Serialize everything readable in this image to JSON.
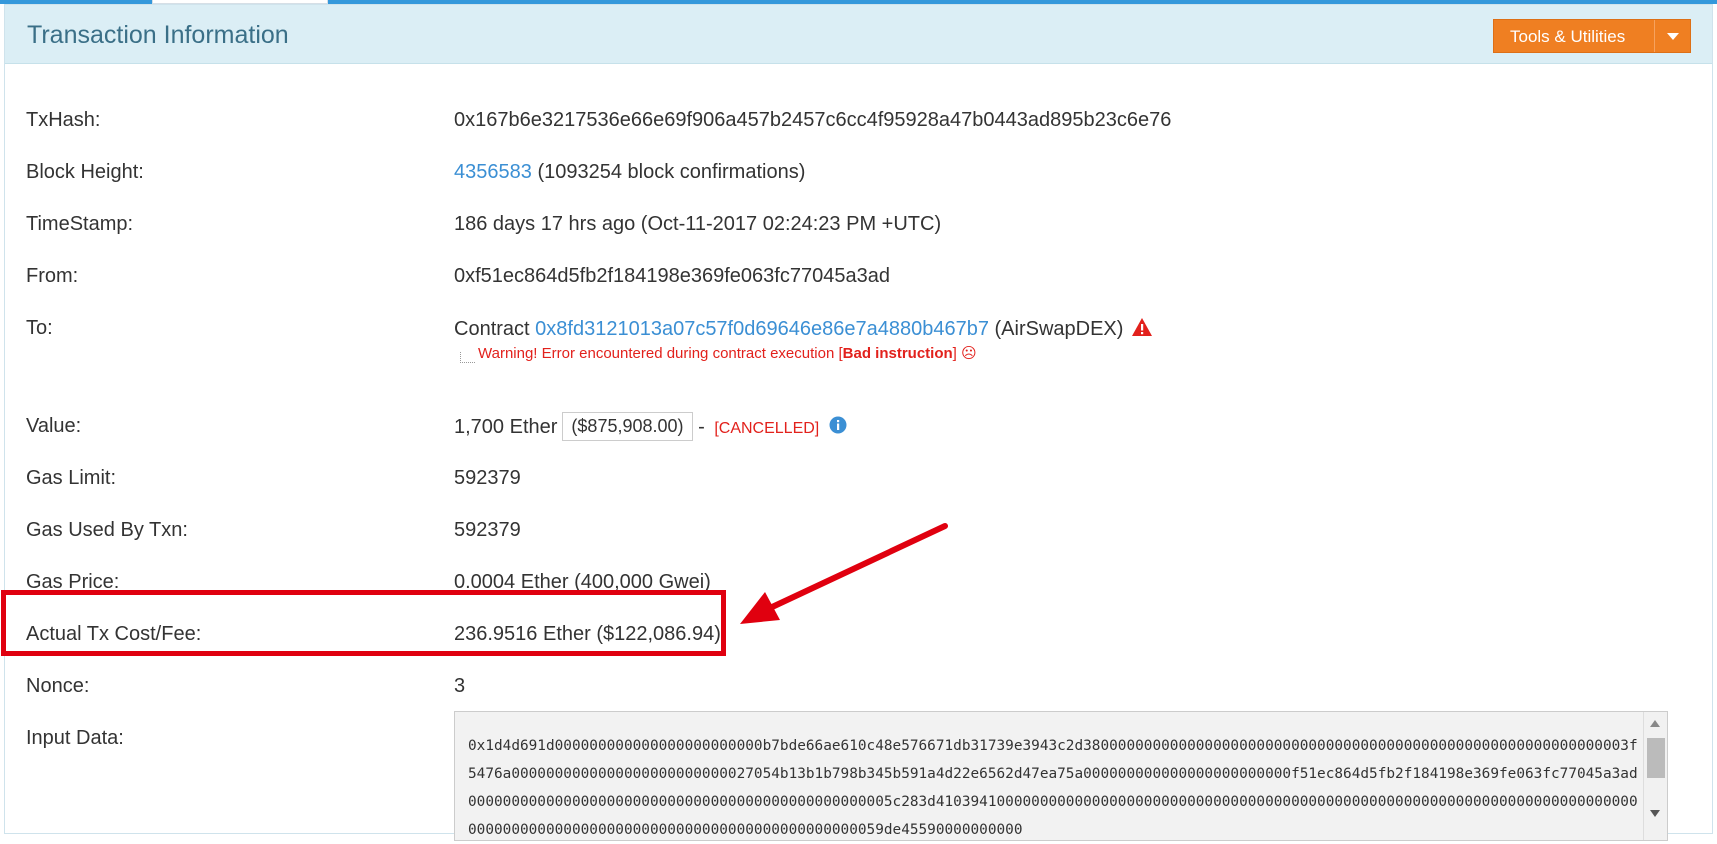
{
  "panel": {
    "title": "Transaction Information",
    "tools_button": "Tools & Utilities"
  },
  "rows": {
    "txhash": {
      "label": "TxHash:",
      "value": "0x167b6e3217536e66e69f906a457b2457c6cc4f95928a47b0443ad895b23c6e76"
    },
    "block_height": {
      "label": "Block Height:",
      "block": "4356583",
      "confirmations": "(1093254 block confirmations)"
    },
    "timestamp": {
      "label": "TimeStamp:",
      "value": "186 days 17 hrs ago (Oct-11-2017 02:24:23 PM +UTC)"
    },
    "from": {
      "label": "From:",
      "address": "0xf51ec864d5fb2f184198e369fe063fc77045a3ad"
    },
    "to": {
      "label": "To:",
      "prefix": "Contract",
      "address": "0x8fd3121013a07c57f0d69646e86e7a4880b467b7",
      "name": "(AirSwapDEX)",
      "warning_prefix": "Warning! Error encountered during contract execution [",
      "warning_bold": "Bad instruction",
      "warning_suffix": "]",
      "warning_face": "☹"
    },
    "value": {
      "label": "Value:",
      "amount": "1,700 Ether",
      "usd": "($875,908.00)",
      "dash": "-",
      "status": "[CANCELLED]"
    },
    "gas_limit": {
      "label": "Gas Limit:",
      "value": "592379"
    },
    "gas_used": {
      "label": "Gas Used By Txn:",
      "value": "592379"
    },
    "gas_price": {
      "label": "Gas Price:",
      "value": "0.0004 Ether (400,000 Gwei)"
    },
    "tx_fee": {
      "label": "Actual Tx Cost/Fee:",
      "value": "236.9516 Ether ($122,086.94)"
    },
    "nonce": {
      "label": "Nonce:",
      "value": "3"
    },
    "input": {
      "label": "Input Data:",
      "value": "0x1d4d691d000000000000000000000000b7bde66ae610c48e576671db31739e3943c2d380000000000000000000000000000000000000000000000000000000000003f5476a0000000000000000000000000027054b13b1b798b345b591a4d22e6562d47ea75a000000000000000000000000f51ec864d5fb2f184198e369fe063fc77045a3ad0000000000000000000000000000000000000000000000005c283d410394100000000000000000000000000000000000000000000000000000000000000000000000000000000000000000000000000000000000000000000000059de45590000000000"
    }
  },
  "colors": {
    "link": "#3b8fd4",
    "header_bg": "#dbeef5",
    "accent_orange": "#ef7f22",
    "error_red": "#e2211c",
    "highlight_red": "#e0000f"
  },
  "icons": [
    "chevron-down-icon",
    "warning-triangle-icon",
    "info-circle-icon",
    "sad-face-icon",
    "arrow-annotation"
  ]
}
